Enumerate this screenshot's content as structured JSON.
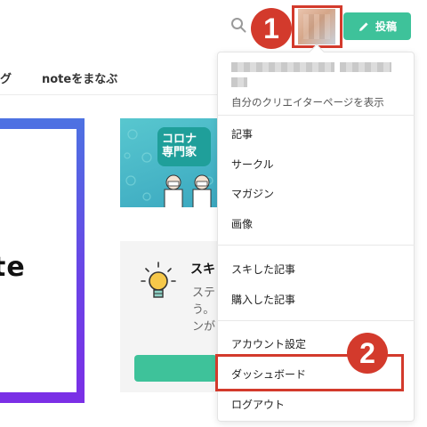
{
  "header": {
    "post_label": "投稿",
    "badge_1": "1",
    "badge_2": "2"
  },
  "nav": {
    "partial_item": "グ",
    "learn_item": "noteをまなぶ"
  },
  "hero": {
    "text": "te"
  },
  "thumbnail": {
    "badge_line1": "コロナ",
    "badge_line2": "専門家"
  },
  "tip": {
    "title": "スキ",
    "body_line1": "ステ",
    "body_line2": "う。",
    "body_line3": "ンが"
  },
  "menu": {
    "creator_page": "自分のクリエイターページを表示",
    "items_group1": [
      "記事",
      "サークル",
      "マガジン",
      "画像"
    ],
    "items_group2": [
      "スキした記事",
      "購入した記事"
    ],
    "items_group3": [
      "アカウント設定",
      "ダッシュボード",
      "ログアウト"
    ]
  },
  "colors": {
    "accent_green": "#3ec29a",
    "highlight_red": "#d33a2c",
    "hero_gradient": [
      "#4d72e2",
      "#7b2fe6"
    ]
  },
  "icons": [
    "search-icon",
    "pencil-icon",
    "lightbulb-icon"
  ]
}
